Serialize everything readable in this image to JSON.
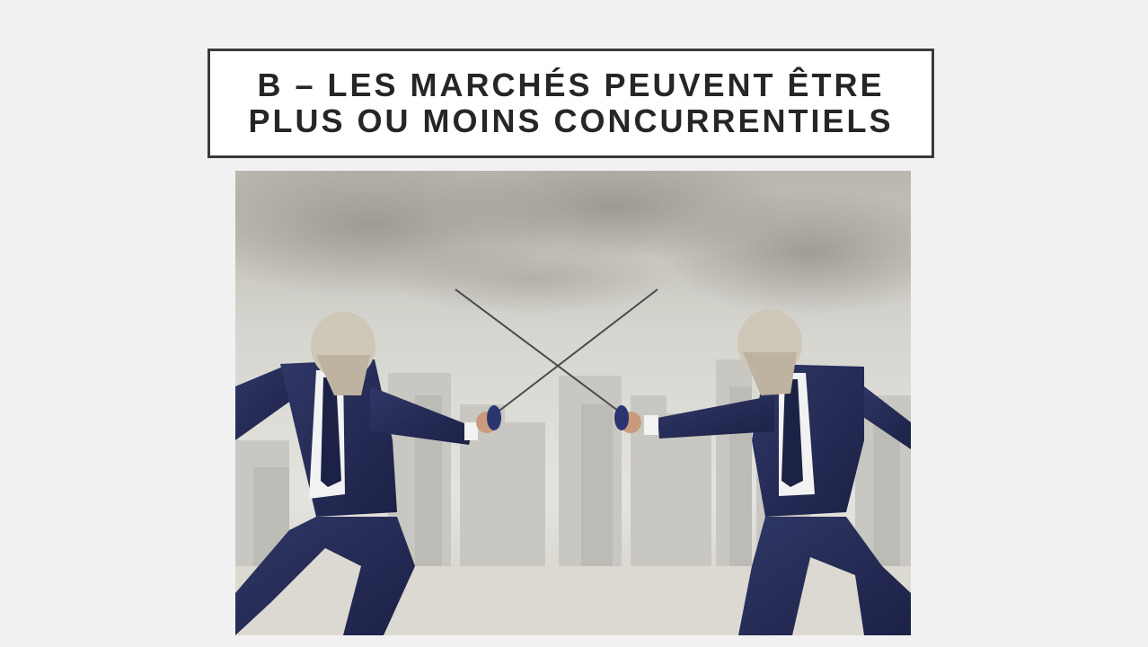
{
  "slide": {
    "title_line_1": "B – LES MARCHÉS PEUVENT ÊTRE",
    "title_line_2": "PLUS OU MOINS CONCURRENTIELS"
  },
  "photo": {
    "subject": "two-businessmen-fencing-illustration"
  },
  "colors": {
    "background": "#f1f1f1",
    "title_border": "#3a3a3a",
    "title_text": "#262626",
    "suit_navy": "#252b55",
    "sky": "#d9d8d2"
  }
}
